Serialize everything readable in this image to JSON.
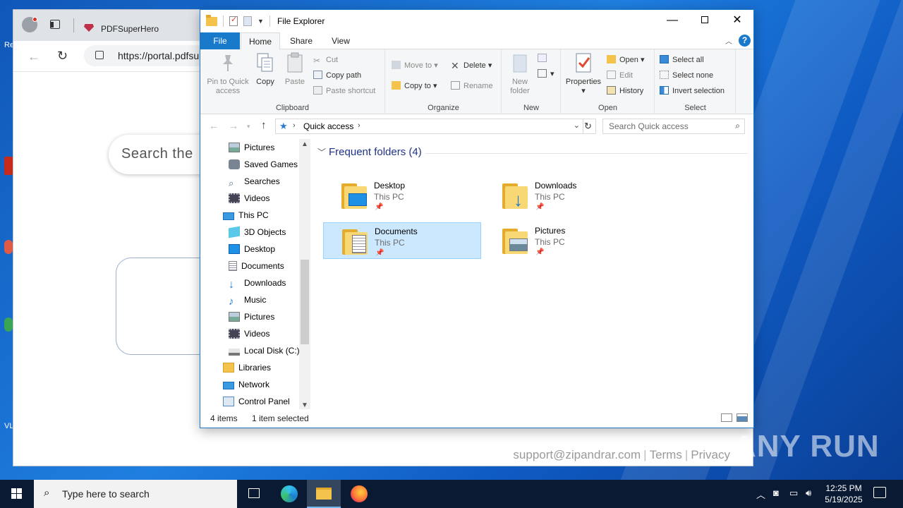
{
  "desktop": {
    "side_labels": [
      "Re",
      "VL"
    ]
  },
  "browser": {
    "tab_title": "PDFSuperHero",
    "url": "https://portal.pdfsu",
    "search_placeholder": "Search the",
    "footer": {
      "support": "support@zipandrar.com",
      "sep": "|",
      "terms": "Terms",
      "privacy": "Privacy"
    }
  },
  "explorer": {
    "title": "File Explorer",
    "tabs": [
      "File",
      "Home",
      "Share",
      "View"
    ],
    "help": "?",
    "ribbon": {
      "clipboard": {
        "label": "Clipboard",
        "pin": "Pin to Quick access",
        "copy": "Copy",
        "paste": "Paste",
        "cut": "Cut",
        "copy_path": "Copy path",
        "paste_shortcut": "Paste shortcut"
      },
      "organize": {
        "label": "Organize",
        "move_to": "Move to",
        "copy_to": "Copy to",
        "delete": "Delete",
        "rename": "Rename"
      },
      "new": {
        "label": "New",
        "new_folder": "New folder"
      },
      "open": {
        "label": "Open",
        "properties": "Properties",
        "open": "Open",
        "edit": "Edit",
        "history": "History"
      },
      "select": {
        "label": "Select",
        "select_all": "Select all",
        "select_none": "Select none",
        "invert": "Invert selection"
      }
    },
    "address": {
      "location": "Quick access",
      "search_placeholder": "Search Quick access"
    },
    "nav_pane": [
      {
        "label": "Pictures",
        "icon": "pictures-icon"
      },
      {
        "label": "Saved Games",
        "icon": "saved-games-icon"
      },
      {
        "label": "Searches",
        "icon": "searches-icon"
      },
      {
        "label": "Videos",
        "icon": "videos-icon"
      },
      {
        "label": "This PC",
        "icon": "this-pc-icon"
      },
      {
        "label": "3D Objects",
        "icon": "3d-objects-icon"
      },
      {
        "label": "Desktop",
        "icon": "desktop-icon"
      },
      {
        "label": "Documents",
        "icon": "documents-icon"
      },
      {
        "label": "Downloads",
        "icon": "downloads-icon"
      },
      {
        "label": "Music",
        "icon": "music-icon"
      },
      {
        "label": "Pictures",
        "icon": "pictures-icon"
      },
      {
        "label": "Videos",
        "icon": "videos-icon"
      },
      {
        "label": "Local Disk (C:)",
        "icon": "local-disk-icon"
      },
      {
        "label": "Libraries",
        "icon": "libraries-icon"
      },
      {
        "label": "Network",
        "icon": "network-icon"
      },
      {
        "label": "Control Panel",
        "icon": "control-panel-icon"
      }
    ],
    "group_header": "Frequent folders (4)",
    "folders": [
      {
        "name": "Desktop",
        "location": "This PC",
        "pinned": true,
        "selected": false
      },
      {
        "name": "Downloads",
        "location": "This PC",
        "pinned": true,
        "selected": false
      },
      {
        "name": "Documents",
        "location": "This PC",
        "pinned": true,
        "selected": true
      },
      {
        "name": "Pictures",
        "location": "This PC",
        "pinned": true,
        "selected": false
      }
    ],
    "status": {
      "count": "4 items",
      "selection": "1 item selected"
    }
  },
  "taskbar": {
    "search_placeholder": "Type here to search",
    "time": "12:25 PM",
    "date": "5/19/2025"
  },
  "watermark": "ANY RUN",
  "colors": {
    "accent": "#1979ca",
    "selection": "#cce8ff",
    "taskbar": "#0b1a33"
  }
}
